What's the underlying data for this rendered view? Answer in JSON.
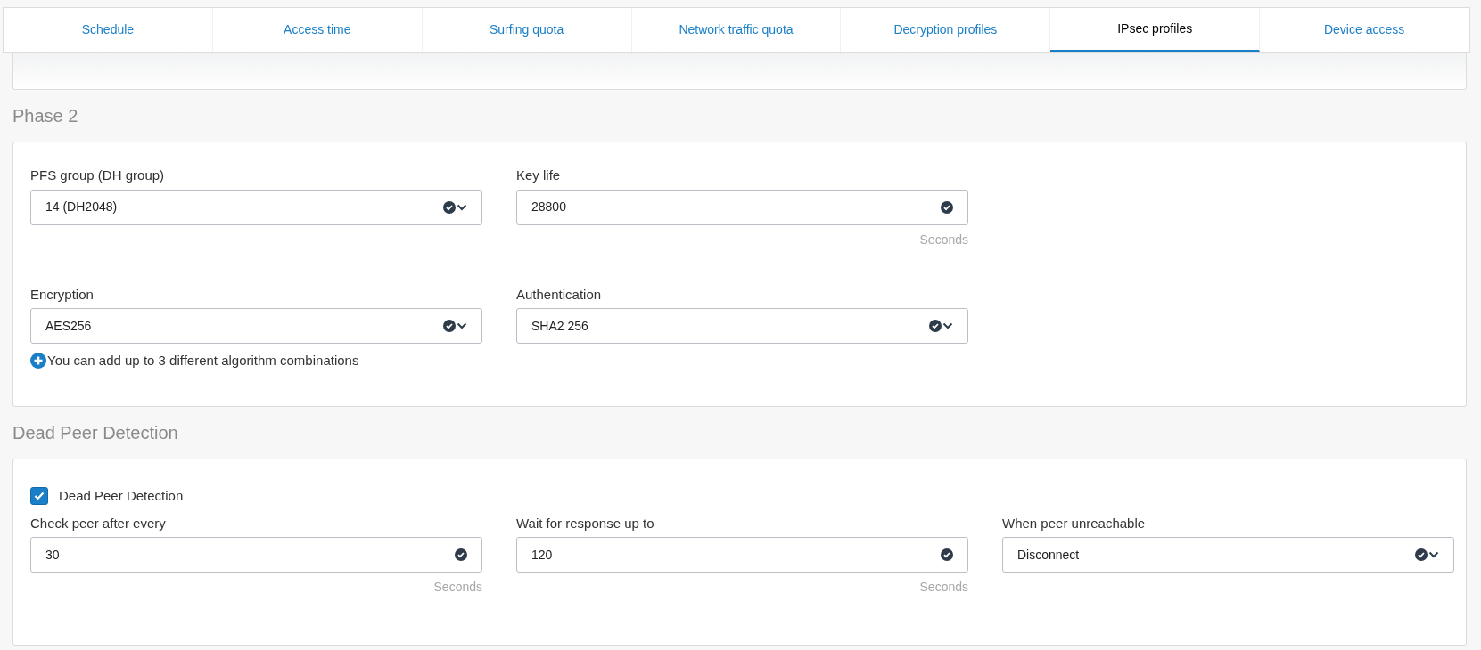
{
  "tabs": [
    {
      "label": "Schedule",
      "selected": false
    },
    {
      "label": "Access time",
      "selected": false
    },
    {
      "label": "Surfing quota",
      "selected": false
    },
    {
      "label": "Network traffic quota",
      "selected": false
    },
    {
      "label": "Decryption profiles",
      "selected": false
    },
    {
      "label": "IPsec profiles",
      "selected": true
    },
    {
      "label": "Device access",
      "selected": false
    }
  ],
  "phase2": {
    "title": "Phase 2",
    "rows": [
      [
        {
          "label": "PFS group (DH group)",
          "value": "14 (DH2048)",
          "kind": "select"
        },
        {
          "label": "Key life",
          "value": "28800",
          "kind": "text",
          "unit": "Seconds"
        }
      ],
      [
        {
          "label": "Encryption",
          "value": "AES256",
          "kind": "select"
        },
        {
          "label": "Authentication",
          "value": "SHA2 256",
          "kind": "select"
        }
      ]
    ],
    "note": "You can add up to 3 different algorithm combinations"
  },
  "dead_peer_detection": {
    "title": "Dead Peer Detection",
    "checkbox": {
      "label": "Dead Peer Detection",
      "checked": true
    },
    "rows": [
      [
        {
          "label": "Check peer after every",
          "value": "30",
          "kind": "text",
          "unit": "Seconds"
        },
        {
          "label": "Wait for response up to",
          "value": "120",
          "kind": "text",
          "unit": "Seconds"
        },
        {
          "label": "When peer unreachable",
          "value": "Disconnect",
          "kind": "select"
        }
      ]
    ]
  }
}
